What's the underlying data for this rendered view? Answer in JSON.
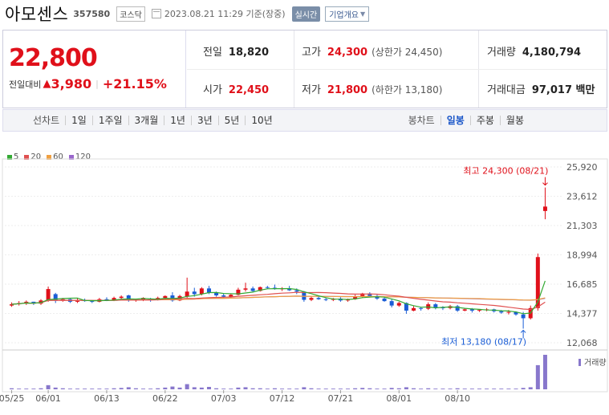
{
  "header": {
    "name": "아모센스",
    "code": "357580",
    "market": "코스닥",
    "date": "2023.08.21 11:29 기준(장중)",
    "realtime_label": "실시간",
    "company_label": "기업개요"
  },
  "price": {
    "current": "22,800",
    "change_label": "전일대비",
    "change_value": "3,980",
    "change_pct": "+21.15%"
  },
  "info": {
    "prev_close_label": "전일",
    "prev_close": "18,820",
    "high_label": "고가",
    "high": "24,300",
    "upper_limit": "(상한가 24,450)",
    "volume_label": "거래량",
    "volume": "4,180,794",
    "open_label": "시가",
    "open": "22,450",
    "low_label": "저가",
    "low": "21,800",
    "lower_limit": "(하한가 13,180)",
    "amount_label": "거래대금",
    "amount": "97,017 백만"
  },
  "periods": {
    "line_label": "선차트",
    "line_items": [
      "1일",
      "1주일",
      "3개월",
      "1년",
      "3년",
      "5년",
      "10년"
    ],
    "candle_label": "봉차트",
    "candle_items": [
      "일봉",
      "주봉",
      "월봉"
    ],
    "active": "일봉"
  },
  "colors": {
    "up": "#e0101a",
    "down": "#1a5dd6",
    "ma5": "#33aa33",
    "ma20": "#e05050",
    "ma60": "#f0a040",
    "ma120": "#9966cc",
    "volume": "#8877cc"
  },
  "chart_data": {
    "type": "candlestick",
    "legend": [
      "5",
      "20",
      "60",
      "120"
    ],
    "y_ticks": [
      "25,920",
      "23,612",
      "21,303",
      "18,994",
      "16,685",
      "14,377",
      "12,068"
    ],
    "ylim": [
      12068,
      25920
    ],
    "x_ticks": [
      "05/25",
      "06/01",
      "06/13",
      "06/22",
      "07/03",
      "07/12",
      "07/21",
      "08/01",
      "08/10"
    ],
    "max_annotation": "최고 24,300 (08/21)",
    "min_annotation": "최저 13,180 (08/17)",
    "volume_label": "거래량",
    "candles": [
      [
        15000,
        15250,
        14900,
        15100
      ],
      [
        15100,
        15350,
        15000,
        15200
      ],
      [
        15200,
        15400,
        15050,
        15300
      ],
      [
        15300,
        15300,
        15050,
        15150
      ],
      [
        15150,
        15500,
        15050,
        15400
      ],
      [
        15400,
        16500,
        15300,
        16300
      ],
      [
        15900,
        16000,
        15200,
        15400
      ],
      [
        15400,
        15600,
        15300,
        15500
      ],
      [
        15500,
        15550,
        15200,
        15300
      ],
      [
        15300,
        15550,
        15200,
        15450
      ],
      [
        15450,
        15550,
        15300,
        15350
      ],
      [
        15350,
        15450,
        15200,
        15300
      ],
      [
        15300,
        15600,
        15250,
        15500
      ],
      [
        15500,
        15650,
        15350,
        15400
      ],
      [
        15400,
        15700,
        15350,
        15600
      ],
      [
        15600,
        15800,
        15500,
        15700
      ],
      [
        15800,
        15850,
        15300,
        15400
      ],
      [
        15400,
        15550,
        15300,
        15450
      ],
      [
        15450,
        15650,
        15350,
        15600
      ],
      [
        15500,
        15600,
        15300,
        15450
      ],
      [
        15450,
        15700,
        15400,
        15600
      ],
      [
        15600,
        15800,
        15500,
        15750
      ],
      [
        15800,
        16050,
        15300,
        15400
      ],
      [
        15400,
        15850,
        15350,
        15750
      ],
      [
        15700,
        17200,
        15600,
        16100
      ],
      [
        16100,
        16400,
        15700,
        15900
      ],
      [
        15900,
        16450,
        15800,
        16350
      ],
      [
        16350,
        16550,
        15900,
        16000
      ],
      [
        16000,
        16100,
        15700,
        15800
      ],
      [
        15800,
        15950,
        15600,
        15700
      ],
      [
        15700,
        15900,
        15600,
        15850
      ],
      [
        15850,
        16400,
        15800,
        16250
      ],
      [
        16250,
        16800,
        16100,
        16350
      ],
      [
        16350,
        16500,
        16050,
        16150
      ],
      [
        16150,
        16500,
        16100,
        16450
      ],
      [
        16450,
        16550,
        16300,
        16400
      ],
      [
        16400,
        16650,
        16250,
        16300
      ],
      [
        16300,
        16450,
        16150,
        16350
      ],
      [
        16350,
        16550,
        16150,
        16200
      ],
      [
        16200,
        16350,
        15900,
        16100
      ],
      [
        16100,
        16150,
        15300,
        15450
      ],
      [
        15450,
        15700,
        15350,
        15600
      ],
      [
        15600,
        15750,
        15450,
        15500
      ],
      [
        15500,
        15600,
        15350,
        15450
      ],
      [
        15450,
        15600,
        15350,
        15550
      ],
      [
        15550,
        15650,
        15300,
        15400
      ],
      [
        15400,
        15550,
        15300,
        15500
      ],
      [
        15500,
        15850,
        15450,
        15700
      ],
      [
        15700,
        16000,
        15600,
        15950
      ],
      [
        15950,
        16050,
        15650,
        15750
      ],
      [
        15750,
        15850,
        15450,
        15550
      ],
      [
        15550,
        15650,
        15300,
        15350
      ],
      [
        15350,
        15500,
        14850,
        15000
      ],
      [
        15000,
        15300,
        14900,
        15200
      ],
      [
        15200,
        15250,
        14350,
        14600
      ],
      [
        14600,
        14950,
        14550,
        14800
      ],
      [
        14800,
        14900,
        14600,
        14750
      ],
      [
        14750,
        15250,
        14650,
        15100
      ],
      [
        15100,
        15200,
        14700,
        14850
      ],
      [
        14850,
        14950,
        14650,
        14800
      ],
      [
        14800,
        15050,
        14700,
        14950
      ],
      [
        14950,
        15050,
        14500,
        14600
      ],
      [
        14600,
        14800,
        14550,
        14700
      ],
      [
        14700,
        14800,
        14450,
        14600
      ],
      [
        14600,
        14700,
        14500,
        14650
      ],
      [
        14650,
        14800,
        14550,
        14700
      ],
      [
        14700,
        14750,
        14450,
        14550
      ],
      [
        14550,
        14650,
        14350,
        14450
      ],
      [
        14450,
        14650,
        14300,
        14500
      ],
      [
        14500,
        14550,
        14200,
        14300
      ],
      [
        14300,
        14500,
        13180,
        14000
      ],
      [
        14000,
        15000,
        13900,
        14800
      ],
      [
        14800,
        19100,
        14600,
        18820
      ],
      [
        22450,
        24300,
        21800,
        22800
      ]
    ],
    "volumes": [
      0.03,
      0.02,
      0.02,
      0.02,
      0.03,
      0.12,
      0.05,
      0.03,
      0.02,
      0.02,
      0.02,
      0.02,
      0.02,
      0.02,
      0.03,
      0.04,
      0.06,
      0.03,
      0.02,
      0.02,
      0.03,
      0.05,
      0.08,
      0.05,
      0.15,
      0.06,
      0.05,
      0.07,
      0.03,
      0.02,
      0.02,
      0.05,
      0.06,
      0.03,
      0.03,
      0.02,
      0.03,
      0.02,
      0.02,
      0.02,
      0.06,
      0.03,
      0.02,
      0.02,
      0.02,
      0.02,
      0.02,
      0.03,
      0.04,
      0.03,
      0.02,
      0.02,
      0.04,
      0.03,
      0.06,
      0.03,
      0.02,
      0.03,
      0.02,
      0.02,
      0.02,
      0.03,
      0.02,
      0.02,
      0.02,
      0.02,
      0.02,
      0.02,
      0.02,
      0.02,
      0.04,
      0.06,
      0.7,
      1.0
    ]
  }
}
